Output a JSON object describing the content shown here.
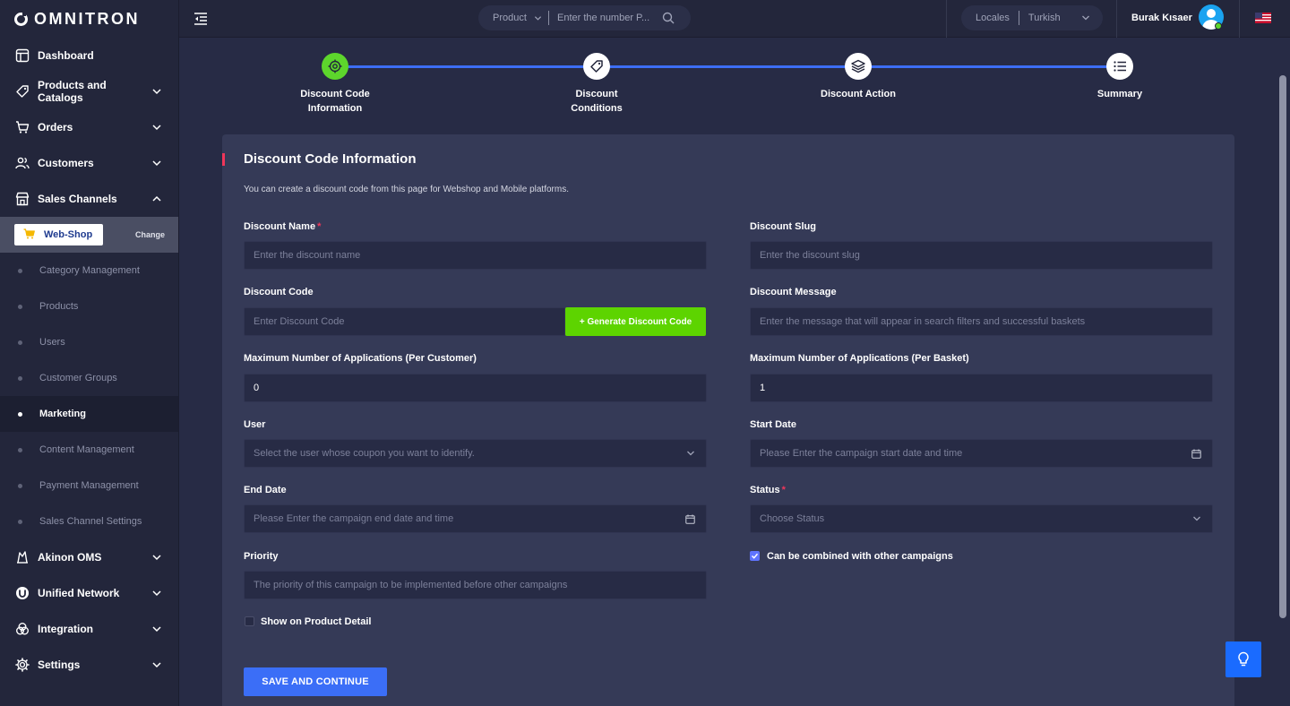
{
  "brand": {
    "name": "OMNITRON"
  },
  "sidebar": {
    "items": [
      {
        "label": "Dashboard",
        "icon": "dashboard-icon"
      },
      {
        "label": "Products and Catalogs",
        "icon": "tag-icon"
      },
      {
        "label": "Orders",
        "icon": "cart-icon"
      },
      {
        "label": "Customers",
        "icon": "users-icon"
      },
      {
        "label": "Sales Channels",
        "icon": "store-icon"
      }
    ],
    "channel": {
      "name": "Web-Shop",
      "change_label": "Change"
    },
    "sub_items": [
      "Category Management",
      "Products",
      "Users",
      "Customer Groups",
      "Marketing",
      "Content Management",
      "Payment Management",
      "Sales Channel Settings"
    ],
    "active_sub_item": "Marketing",
    "bottom_items": [
      {
        "label": "Akinon OMS",
        "icon": "oms-icon"
      },
      {
        "label": "Unified Network",
        "icon": "network-icon"
      },
      {
        "label": "Integration",
        "icon": "integration-icon"
      },
      {
        "label": "Settings",
        "icon": "gear-icon"
      }
    ]
  },
  "topbar": {
    "search_type": "Product",
    "search_placeholder": "Enter the number P...",
    "locale_label": "Locales",
    "locale_value": "Turkish",
    "user_name": "Burak Kısaer"
  },
  "stepper": {
    "steps": [
      {
        "label": "Discount Code Information",
        "icon": "target-icon",
        "active": true
      },
      {
        "label": "Discount Conditions",
        "icon": "tag-icon",
        "active": false
      },
      {
        "label": "Discount Action",
        "icon": "layers-icon",
        "active": false
      },
      {
        "label": "Summary",
        "icon": "list-icon",
        "active": false
      }
    ]
  },
  "form": {
    "title": "Discount Code Information",
    "description": "You can create a discount code from this page for Webshop and Mobile platforms.",
    "discount_name": {
      "label": "Discount Name",
      "placeholder": "Enter the discount name",
      "required": true
    },
    "discount_slug": {
      "label": "Discount Slug",
      "placeholder": "Enter the discount slug"
    },
    "discount_code": {
      "label": "Discount Code",
      "placeholder": "Enter Discount Code",
      "generate_label": "+ Generate Discount Code"
    },
    "discount_message": {
      "label": "Discount Message",
      "placeholder": "Enter the message that will appear in search filters and successful baskets"
    },
    "max_per_customer": {
      "label": "Maximum Number of Applications (Per Customer)",
      "value": "0"
    },
    "max_per_basket": {
      "label": "Maximum Number of Applications (Per Basket)",
      "value": "1"
    },
    "user": {
      "label": "User",
      "placeholder": "Select the user whose coupon you want to identify."
    },
    "start_date": {
      "label": "Start Date",
      "placeholder": "Please Enter the campaign start date and time"
    },
    "end_date": {
      "label": "End Date",
      "placeholder": "Please Enter the campaign end date and time"
    },
    "status": {
      "label": "Status",
      "placeholder": "Choose Status",
      "required": true
    },
    "priority": {
      "label": "Priority",
      "placeholder": "The priority of this campaign to be implemented before other campaigns"
    },
    "combinable": {
      "label": "Can be combined with other campaigns",
      "checked": true
    },
    "show_on_detail": {
      "label": "Show on Product Detail",
      "checked": false
    },
    "save_label": "SAVE AND CONTINUE"
  },
  "colors": {
    "accent": "#3b6ef7",
    "success": "#5dd400",
    "required": "#f0365a",
    "background": "#272b45",
    "card": "#353a57"
  }
}
